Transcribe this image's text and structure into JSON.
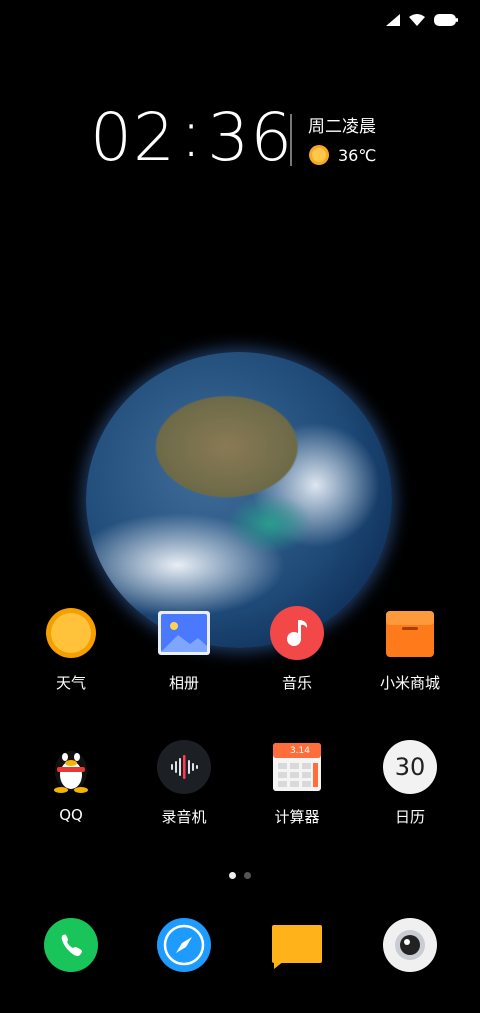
{
  "clock": {
    "hours": "02",
    "sep": ":",
    "minutes": "36"
  },
  "date": {
    "weekday_period": "周二凌晨"
  },
  "weather": {
    "temperature": "36℃",
    "icon": "sun-icon"
  },
  "apps_row1": [
    {
      "label": "天气",
      "icon": "weather-sun-icon"
    },
    {
      "label": "相册",
      "icon": "gallery-icon"
    },
    {
      "label": "音乐",
      "icon": "music-icon"
    },
    {
      "label": "小米商城",
      "icon": "mi-store-icon"
    }
  ],
  "apps_row2": [
    {
      "label": "QQ",
      "icon": "qq-penguin-icon"
    },
    {
      "label": "录音机",
      "icon": "recorder-icon"
    },
    {
      "label": "计算器",
      "icon": "calculator-icon",
      "badge": "3.14"
    },
    {
      "label": "日历",
      "icon": "calendar-icon",
      "day": "30"
    }
  ],
  "dock": [
    {
      "icon": "phone-icon"
    },
    {
      "icon": "browser-compass-icon"
    },
    {
      "icon": "messages-icon"
    },
    {
      "icon": "camera-icon"
    }
  ],
  "pager": {
    "pages": 2,
    "active": 1
  },
  "colors": {
    "phone": "#19c45a",
    "browser": "#1e9bff",
    "messages": "#ffb21a",
    "music": "#f24848",
    "store": "#ff7a1a",
    "weather": "#ffb522"
  }
}
